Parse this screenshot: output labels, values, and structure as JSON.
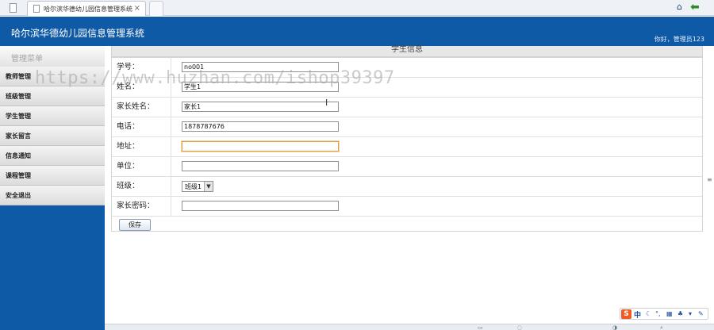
{
  "browser": {
    "tab_title": "哈尔滨华德幼儿园信息管理系统",
    "tab_close": "×",
    "home_icon": "house-icon",
    "back_icon": "back-arrow-icon"
  },
  "header": {
    "title": "哈尔滨华德幼儿园信息管理系统",
    "welcome": "你好，管理员123"
  },
  "sidebar": {
    "title": "管理菜单",
    "items": [
      {
        "label": "教师管理"
      },
      {
        "label": "班级管理"
      },
      {
        "label": "学生管理"
      },
      {
        "label": "家长留言"
      },
      {
        "label": "信息通知"
      },
      {
        "label": "课程管理"
      },
      {
        "label": "安全退出"
      }
    ]
  },
  "form": {
    "section_title": "学生信息",
    "fields": [
      {
        "label": "学号：",
        "value": "no001"
      },
      {
        "label": "姓名：",
        "value": "学生1"
      },
      {
        "label": "家长姓名：",
        "value": "家长1"
      },
      {
        "label": "电话：",
        "value": "1878787676"
      },
      {
        "label": "地址：",
        "value": ""
      },
      {
        "label": "单位：",
        "value": ""
      },
      {
        "label": "班级：",
        "value": "班级1"
      },
      {
        "label": "家长密码：",
        "value": ""
      }
    ],
    "save_label": "保存"
  },
  "watermark": "https://www.huzhan.com/ishop39397",
  "ime": {
    "logo": "S",
    "mode": "中",
    "icons": [
      "moon-icon",
      "comma-icon",
      "keyboard-icon",
      "shirt-icon",
      "wrench-icon"
    ]
  },
  "colors": {
    "brand_blue": "#0f5aa6",
    "focus_border": "#d9a24a"
  }
}
